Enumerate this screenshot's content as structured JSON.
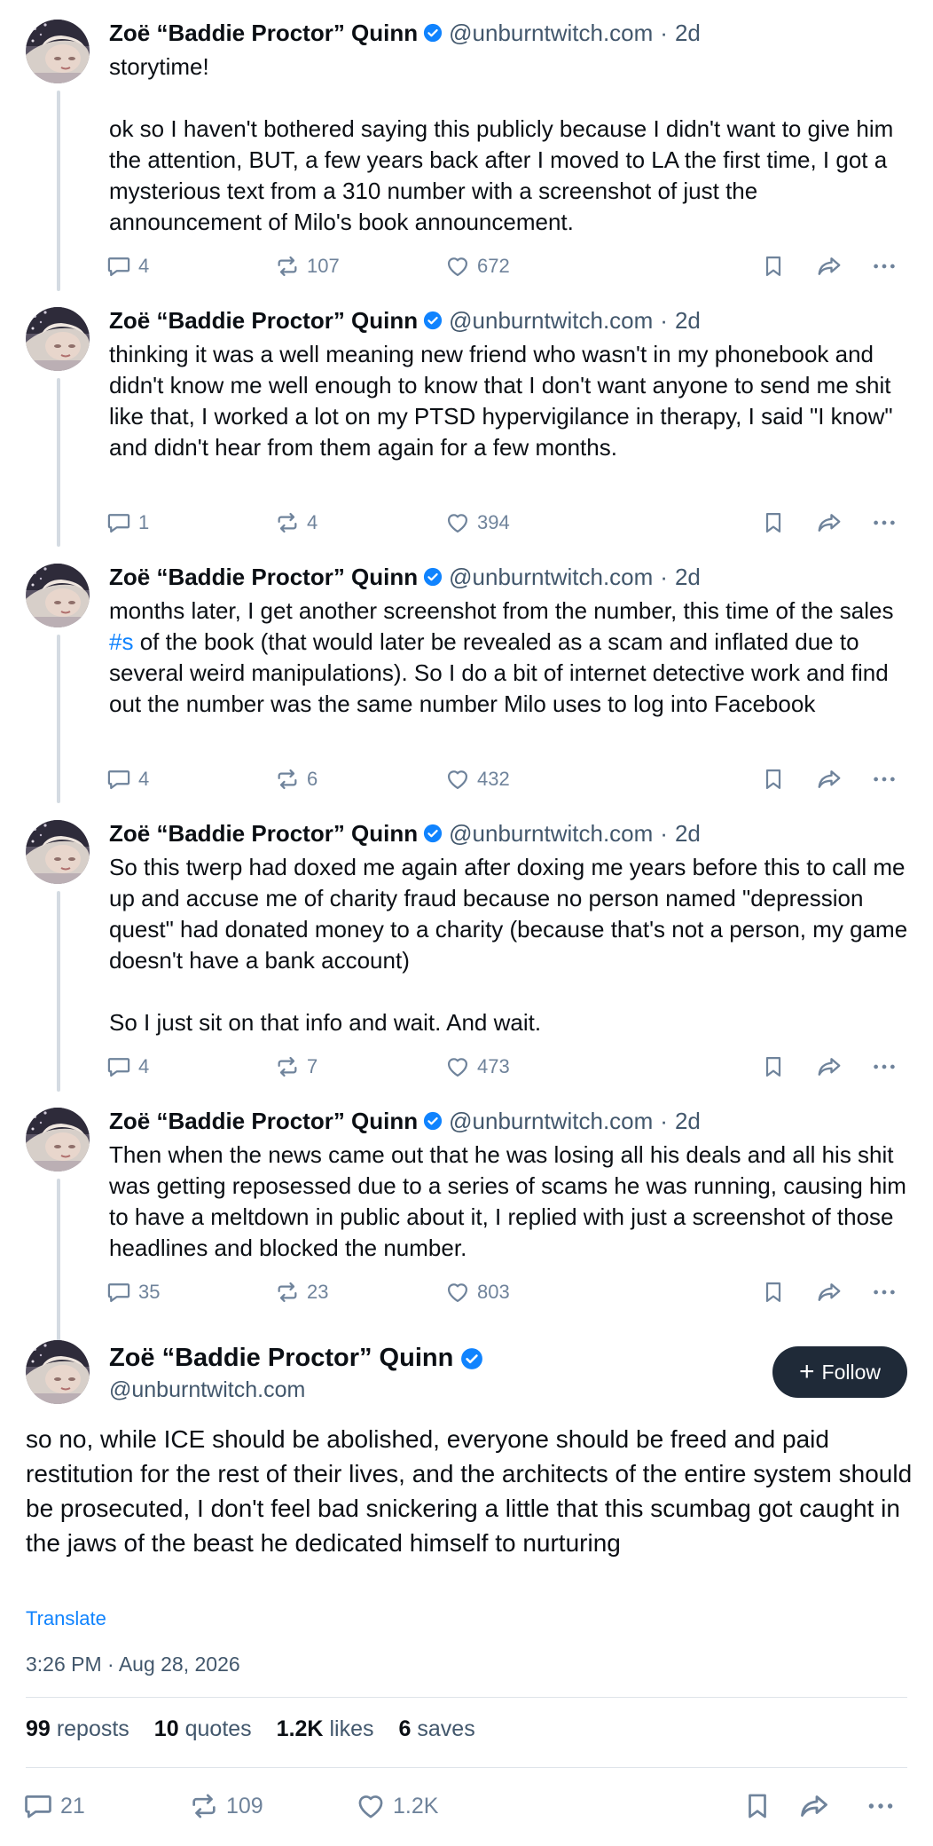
{
  "posts": [
    {
      "name": "Zoë “Baddie Proctor” Quinn",
      "handle": "@unburntwitch.com",
      "separator": "·",
      "time": "2d",
      "text": "storytime!\n\nok so I haven't bothered saying this publicly because I didn't want to give him the attention, BUT, a few years back after I moved to LA the first time, I got a mysterious text from a 310 number with a screenshot of just the announcement of Milo's book announcement.",
      "replies": "4",
      "reposts": "107",
      "likes": "672"
    },
    {
      "name": "Zoë “Baddie Proctor” Quinn",
      "handle": "@unburntwitch.com",
      "separator": "·",
      "time": "2d",
      "text": "thinking it was a well meaning new friend who wasn't in my phonebook and didn't know me well enough to know that I don't want anyone to send me shit like that, I worked a lot on my PTSD hypervigilance in therapy, I said \"I know\" and didn't hear from them again for a few months.",
      "replies": "1",
      "reposts": "4",
      "likes": "394"
    },
    {
      "name": "Zoë “Baddie Proctor” Quinn",
      "handle": "@unburntwitch.com",
      "separator": "·",
      "time": "2d",
      "text_before": "months later, I get another screenshot from the number, this time of the sales ",
      "hashtag": "#s",
      "text_after": " of the book (that would later be revealed as a scam and inflated due to several weird manipulations). So I do a bit of internet detective work and find out the number was the same number Milo uses to log into Facebook",
      "replies": "4",
      "reposts": "6",
      "likes": "432"
    },
    {
      "name": "Zoë “Baddie Proctor” Quinn",
      "handle": "@unburntwitch.com",
      "separator": "·",
      "time": "2d",
      "text": "So this twerp had doxed me again after doxing me years before this to call me up and accuse me of charity fraud because no person named \"depression quest\" had donated money to a charity (because that's not a person, my game doesn't have a bank account)\n\nSo I just sit on that info and wait. And wait.",
      "replies": "4",
      "reposts": "7",
      "likes": "473"
    },
    {
      "name": "Zoë “Baddie Proctor” Quinn",
      "handle": "@unburntwitch.com",
      "separator": "·",
      "time": "2d",
      "text": "Then when the news came out that he was losing all his deals and all his shit was getting reposessed due to a series of scams he was running, causing him to have a meltdown in public about it, I replied with just a screenshot of those headlines and blocked the number.",
      "replies": "35",
      "reposts": "23",
      "likes": "803"
    }
  ],
  "main": {
    "name": "Zoë “Baddie Proctor” Quinn",
    "handle": "@unburntwitch.com",
    "follow_label": "Follow",
    "text": "so no, while ICE should be abolished, everyone should be freed and paid restitution for the rest of their lives, and the architects of the entire system should be prosecuted, I don't feel bad snickering a little that this scumbag got caught in the jaws of the beast he dedicated himself to nurturing",
    "translate_label": "Translate",
    "timestamp": "3:26 PM · Aug 28, 2026",
    "stats": {
      "reposts_count": "99",
      "reposts_label": "reposts",
      "quotes_count": "10",
      "quotes_label": "quotes",
      "likes_count": "1.2K",
      "likes_label": "likes",
      "saves_count": "6",
      "saves_label": "saves"
    },
    "replies": "21",
    "reposts": "109",
    "likes": "1.2K"
  },
  "icons": {
    "verified": "verified-badge-icon",
    "reply": "reply-icon",
    "repost": "repost-icon",
    "like": "heart-icon",
    "bookmark": "bookmark-icon",
    "share": "share-icon",
    "more": "more-icon"
  },
  "colors": {
    "accent": "#1083fe",
    "verified": "#1083fe",
    "muted_text": "#42576c",
    "action_icons": "#6f839b",
    "thread_line": "#d4dbe2",
    "follow_button": "#1f2a38"
  }
}
